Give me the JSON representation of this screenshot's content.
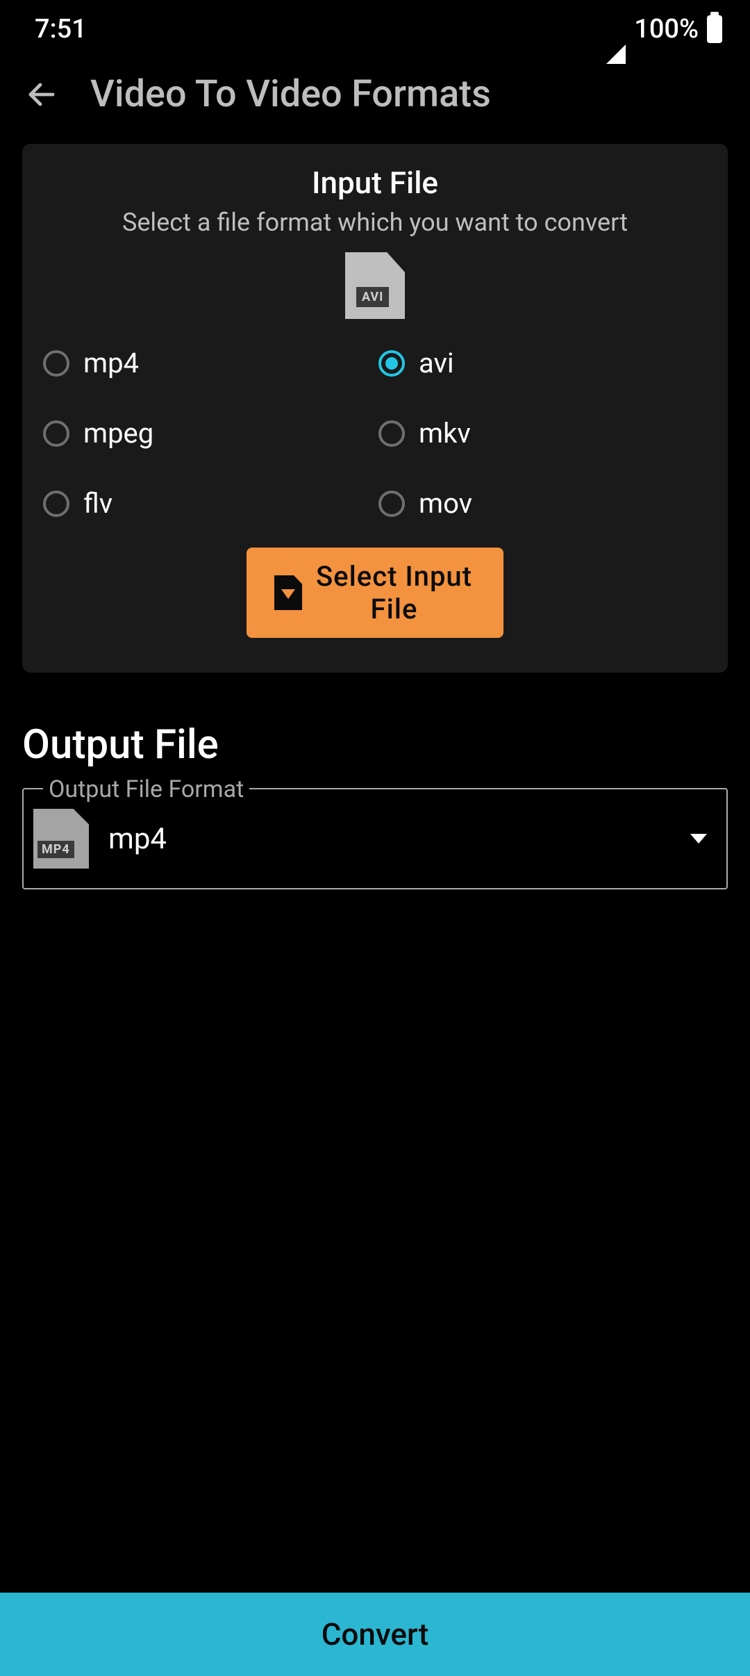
{
  "status": {
    "time": "7:51",
    "battery_pct": "100%"
  },
  "header": {
    "title": "Video To Video Formats"
  },
  "input_card": {
    "title": "Input File",
    "subtitle": "Select a file format which you want to convert",
    "selected_format_badge": "AVI",
    "formats": [
      {
        "label": "mp4",
        "selected": false
      },
      {
        "label": "avi",
        "selected": true
      },
      {
        "label": "mpeg",
        "selected": false
      },
      {
        "label": "mkv",
        "selected": false
      },
      {
        "label": "flv",
        "selected": false
      },
      {
        "label": "mov",
        "selected": false
      }
    ],
    "select_button_label": "Select Input File"
  },
  "output": {
    "heading": "Output File",
    "legend": "Output File Format",
    "icon_badge": "MP4",
    "value": "mp4"
  },
  "convert_label": "Convert"
}
